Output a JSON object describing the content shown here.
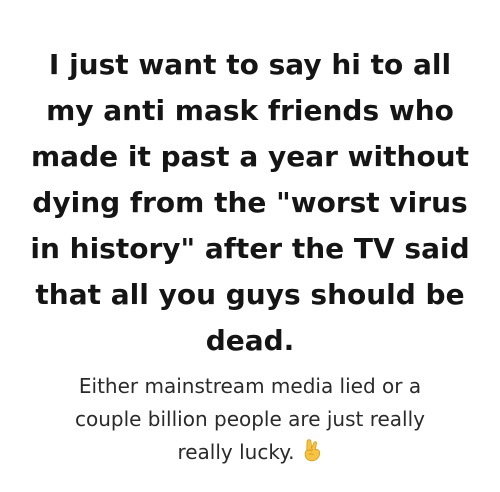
{
  "headline": {
    "lines": [
      "I just want to say hi to all",
      "my anti mask friends who",
      "made it past a year without",
      "dying from the \"worst virus",
      "in history\" after the TV said",
      "that all you guys should  be",
      "dead."
    ]
  },
  "caption": {
    "lines": [
      "Either mainstream media lied or a",
      "couple billion people are just really",
      "really lucky."
    ],
    "emoji_icon": "crossed-fingers-icon"
  },
  "colors": {
    "background": "#ffffff",
    "headline_text": "#151515",
    "caption_text": "#2a2a2a",
    "emoji_skin": "#f6c343"
  }
}
